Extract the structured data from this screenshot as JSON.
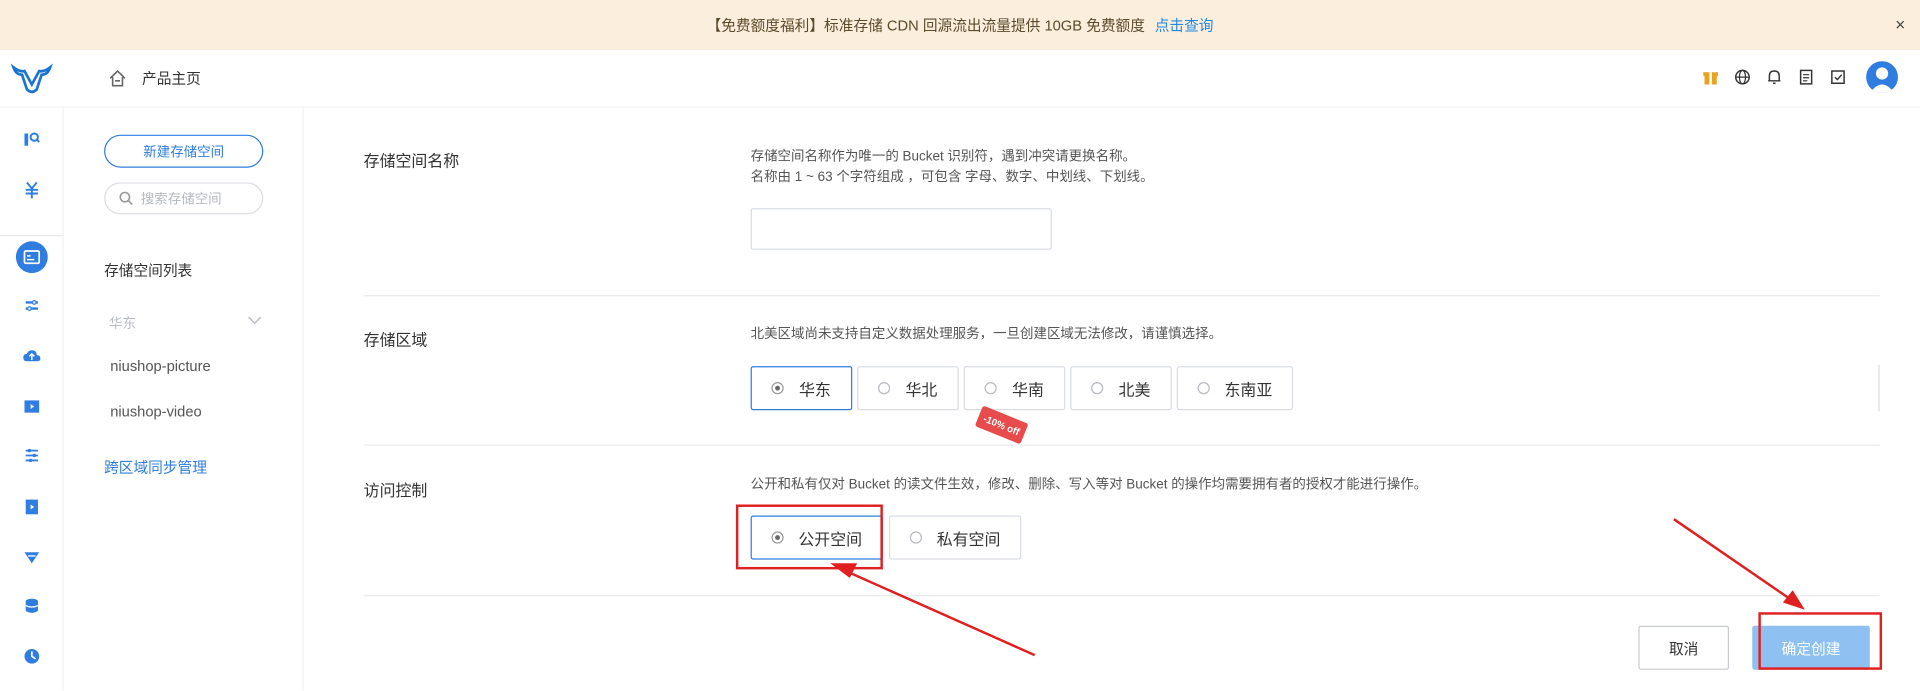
{
  "banner": {
    "text": "【免费额度福利】标准存储 CDN 回源流出流量提供 10GB 免费额度",
    "link": "点击查询",
    "close": "×"
  },
  "header": {
    "home_label": "产品主页"
  },
  "sidebar": {
    "new_bucket_button": "新建存储空间",
    "search_placeholder": "搜索存储空间",
    "list_title": "存储空间列表",
    "region": "华东",
    "buckets": [
      "niushop-picture",
      "niushop-video"
    ],
    "sync_link": "跨区域同步管理"
  },
  "form": {
    "name": {
      "label": "存储空间名称",
      "desc_line1": "存储空间名称作为唯一的 Bucket 识别符，遇到冲突请更换名称。",
      "desc_line2": "名称由 1 ~ 63 个字符组成 ，可包含 字母、数字、中划线、下划线。",
      "value": ""
    },
    "region": {
      "label": "存储区域",
      "desc": "北美区域尚未支持自定义数据处理服务，一旦创建区域无法修改，请谨慎选择。",
      "options": [
        "华东",
        "华北",
        "华南",
        "北美",
        "东南亚"
      ],
      "selected": "华东",
      "promo": "-10% off"
    },
    "access": {
      "label": "访问控制",
      "desc": "公开和私有仅对 Bucket 的读文件生效，修改、删除、写入等对 Bucket 的操作均需要拥有者的授权才能进行操作。",
      "options": [
        "公开空间",
        "私有空间"
      ],
      "selected": "公开空间"
    },
    "cancel_button": "取消",
    "confirm_button": "确定创建"
  },
  "colors": {
    "accent": "#2f7de1",
    "banner_bg": "#fbeedd",
    "annotation": "#e02020",
    "confirm_bg": "#8ec1f1"
  }
}
